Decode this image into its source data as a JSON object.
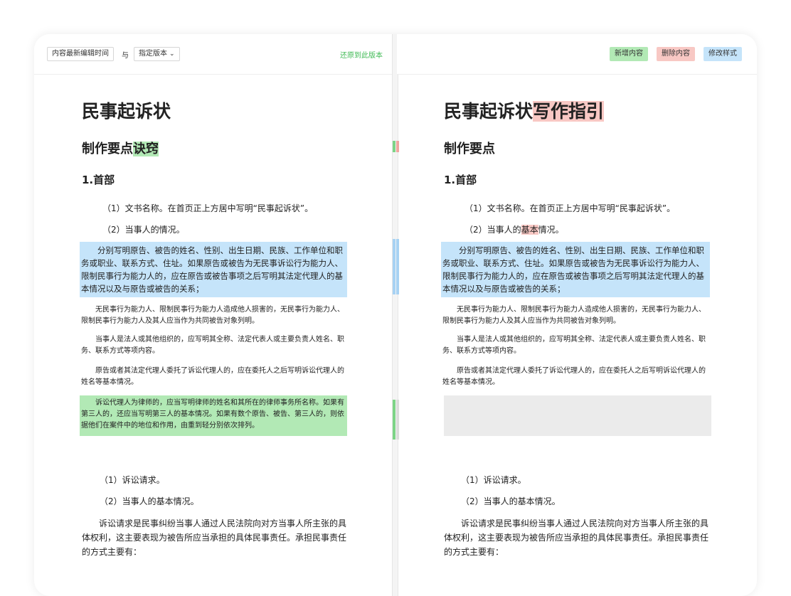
{
  "colors": {
    "added": "#b2e9b5",
    "deleted": "#f8c8c4",
    "modified": "#c5e4fa",
    "restore_link": "#3fba54"
  },
  "toolbar_left": {
    "compare_from": "内容最新编辑时间",
    "with_text": "与",
    "compare_to": "指定版本",
    "dropdown_icon": "chevron-down-icon",
    "restore_label": "还原到此版本"
  },
  "toolbar_right": {
    "legend_added": "新增内容",
    "legend_deleted": "删除内容",
    "legend_modified": "修改样式"
  },
  "left_doc": {
    "title": "民事起诉状",
    "subtitle_prefix": "制作要点",
    "subtitle_added": "诀窍",
    "section1": "1.首部",
    "item1": "（1）文书名称。在首页正上方居中写明“民事起诉状”。",
    "item2": "（2）当事人的情况。",
    "para_modified": "分别写明原告、被告的姓名、性别、出生日期、民族、工作单位和职务或职业、联系方式、住址。如果原告或被告为无民事诉讼行为能力人、限制民事行为能力人的，应在原告或被告事项之后写明其法定代理人的基本情况以及与原告或被告的关系；",
    "para_a": "无民事行为能力人、限制民事行为能力人造成他人损害的，无民事行为能力人、限制民事行为能力人及其人应当作为共同被告对象列明。",
    "para_b": "当事人是法人或其他组织的，应写明其全称、法定代表人或主要负责人姓名、职务、联系方式等项内容。",
    "para_c": "原告或者其法定代理人委托了诉讼代理人的，应在委托人之后写明诉讼代理人的姓名等基本情况。",
    "para_added": "诉讼代理人为律师的，应当写明律师的姓名和其所在的律师事务所名称。如果有第三人的，还应当写明第三人的基本情况。如果有数个原告、被告、第三人的，则依据他们在案件中的地位和作用，由重到轻分别依次排列。",
    "item3": "（1）诉讼请求。",
    "item4": "（2）当事人的基本情况。",
    "para_body": "诉讼请求是民事纠纷当事人通过人民法院向对方当事人所主张的具体权利，这主要表现为被告所应当承担的具体民事责任。承担民事责任的方式主要有："
  },
  "right_doc": {
    "title_prefix": "民事起诉状",
    "title_deleted": "写作指引",
    "subtitle": "制作要点",
    "section1": "1.首部",
    "item1": "（1）文书名称。在首页正上方居中写明“民事起诉状”。",
    "item2_prefix": "（2）当事人的",
    "item2_deleted": "基本",
    "item2_suffix": "情况。",
    "para_modified": "分别写明原告、被告的姓名、性别、出生日期、民族、工作单位和职务或职业、联系方式、住址。如果原告或被告为无民事诉讼行为能力人、限制民事行为能力人的，应在原告或被告事项之后写明其法定代理人的基本情况以及与原告或被告的关系；",
    "para_a": "无民事行为能力人、限制民事行为能力人造成他人损害的，无民事行为能力人、限制民事行为能力人及其人应当作为共同被告对象列明。",
    "para_b": "当事人是法人或其他组织的，应写明其全称、法定代表人或主要负责人姓名、职务、联系方式等项内容。",
    "para_c": "原告或者其法定代理人委托了诉讼代理人的，应在委托人之后写明诉讼代理人的姓名等基本情况。",
    "item3": "（1）诉讼请求。",
    "item4": "（2）当事人的基本情况。",
    "para_body": "诉讼请求是民事纠纷当事人通过人民法院向对方当事人所主张的具体权利，这主要表现为被告所应当承担的具体民事责任。承担民事责任的方式主要有："
  }
}
